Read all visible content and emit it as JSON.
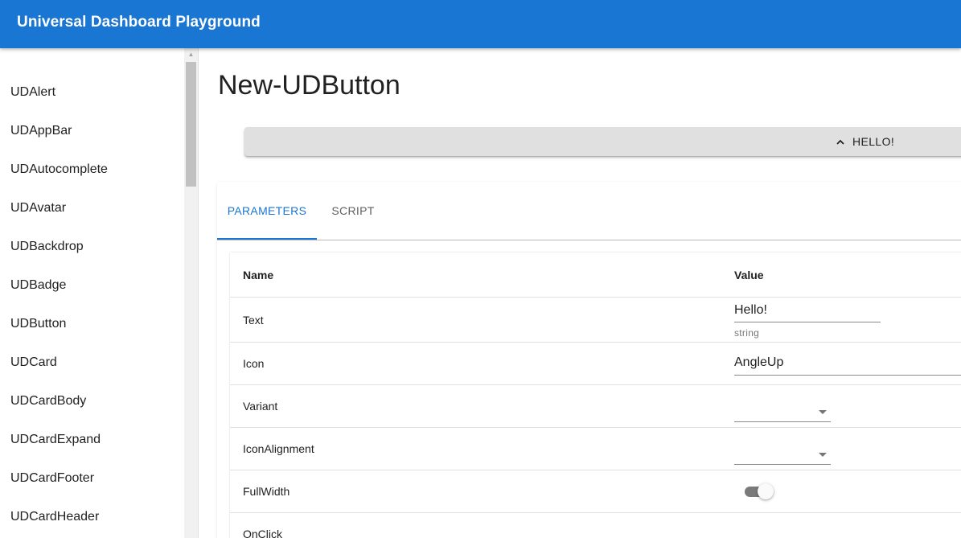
{
  "appbar": {
    "title": "Universal Dashboard Playground"
  },
  "sidebar": {
    "items": [
      {
        "label": "UDAlert"
      },
      {
        "label": "UDAppBar"
      },
      {
        "label": "UDAutocomplete"
      },
      {
        "label": "UDAvatar"
      },
      {
        "label": "UDBackdrop"
      },
      {
        "label": "UDBadge"
      },
      {
        "label": "UDButton"
      },
      {
        "label": "UDCard"
      },
      {
        "label": "UDCardBody"
      },
      {
        "label": "UDCardExpand"
      },
      {
        "label": "UDCardFooter"
      },
      {
        "label": "UDCardHeader"
      }
    ]
  },
  "main": {
    "page_title": "New-UDButton",
    "demo_button": {
      "label": "HELLO!",
      "icon": "chevron-up-icon"
    },
    "tabs": [
      {
        "label": "PARAMETERS",
        "active": true
      },
      {
        "label": "SCRIPT",
        "active": false
      }
    ],
    "table": {
      "headers": {
        "name": "Name",
        "value": "Value"
      },
      "rows": {
        "text": {
          "name": "Text",
          "value": "Hello!",
          "helper": "string"
        },
        "icon": {
          "name": "Icon",
          "value": "AngleUp"
        },
        "variant": {
          "name": "Variant",
          "value": ""
        },
        "icon_alignment": {
          "name": "IconAlignment",
          "value": ""
        },
        "full_width": {
          "name": "FullWidth",
          "checked": false
        },
        "on_click": {
          "name": "OnClick"
        }
      }
    }
  },
  "colors": {
    "primary": "#1976d2",
    "button_bg": "#e0e0e0",
    "switch_track": "#7a7a7a"
  }
}
